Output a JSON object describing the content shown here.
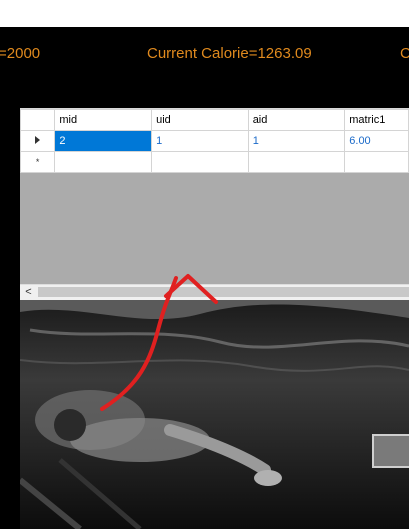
{
  "stats": {
    "target": "=2000",
    "current": "Current Calorie=1263.09",
    "third": "C"
  },
  "grid": {
    "columns": [
      "mid",
      "uid",
      "aid",
      "matric1"
    ],
    "rows": [
      {
        "mid": "2",
        "uid": "1",
        "aid": "1",
        "matric1": "6.00"
      }
    ],
    "new_row_marker": "*"
  },
  "scrollbar": {
    "left_arrow": "<"
  },
  "colors": {
    "accent_text": "#e08a1e",
    "selection": "#0078d7",
    "grid_background": "#ababab",
    "annotation_arrow": "#e02020"
  }
}
